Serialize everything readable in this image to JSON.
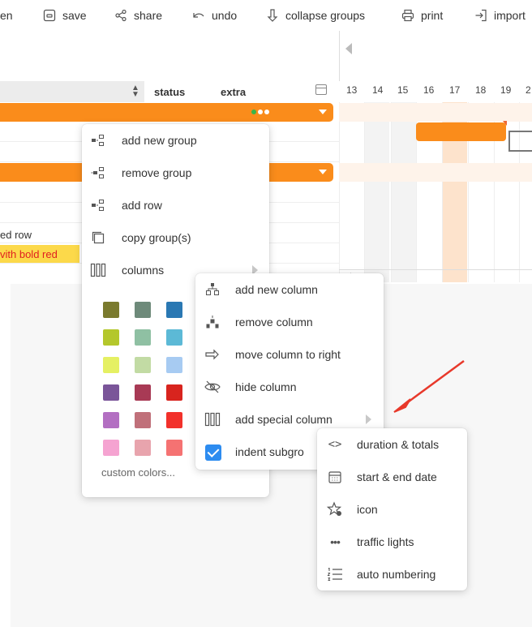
{
  "toolbar": {
    "items": [
      {
        "label": "en",
        "icon": "none"
      },
      {
        "label": "save",
        "icon": "save-icon"
      },
      {
        "label": "share",
        "icon": "share-icon"
      },
      {
        "label": "undo",
        "icon": "undo-icon"
      },
      {
        "label": "collapse groups",
        "icon": "collapse-icon"
      },
      {
        "label": "print",
        "icon": "print-icon"
      },
      {
        "label": "import",
        "icon": "import-icon"
      }
    ]
  },
  "grid": {
    "headers": {
      "status": "status",
      "extra": "extra"
    },
    "days": [
      "13",
      "14",
      "15",
      "16",
      "17",
      "18",
      "19",
      "2"
    ],
    "rows": {
      "red_row_text": "ed row",
      "bold_red_text": "vith bold red"
    },
    "colors": {
      "group": "#fa8c1b",
      "highlight_day": "#fde3cc",
      "yellow": "#fcd94a",
      "bold_red": "#e02020"
    }
  },
  "context_menu": {
    "items": [
      {
        "label": "add new group",
        "icon": "add-group-icon"
      },
      {
        "label": "remove group",
        "icon": "remove-group-icon"
      },
      {
        "label": "add row",
        "icon": "add-row-icon"
      },
      {
        "label": "copy group(s)",
        "icon": "copy-icon"
      },
      {
        "label": "columns",
        "icon": "columns-icon"
      }
    ],
    "swatches": [
      [
        "#7a7a2e",
        "#6e8a7a",
        "#2a78b3"
      ],
      [
        "#b4c72c",
        "#8fc0a3",
        "#5cb9d6"
      ],
      [
        "#e5f063",
        "#c2dba4",
        "#a7cbf2"
      ],
      [
        "#7a5599",
        "#a83a55",
        "#d8241e"
      ],
      [
        "#b36fc2",
        "#c0707a",
        "#f2312b"
      ],
      [
        "#f5a3d1",
        "#e8a4ad",
        "#f57272"
      ]
    ],
    "custom_colors": "custom colors..."
  },
  "columns_menu": {
    "items": [
      {
        "label": "add new column",
        "icon": "add-column-icon"
      },
      {
        "label": "remove column",
        "icon": "remove-column-icon"
      },
      {
        "label": "move column to right",
        "icon": "arrow-right-icon"
      },
      {
        "label": "hide column",
        "icon": "eye-off-icon"
      },
      {
        "label": "add special column",
        "icon": "columns-icon"
      },
      {
        "label": "indent subgro",
        "icon": "checkbox-icon"
      }
    ]
  },
  "special_menu": {
    "items": [
      {
        "label": "duration & totals",
        "icon": "code-icon"
      },
      {
        "label": "start & end date",
        "icon": "calendar-icon"
      },
      {
        "label": "icon",
        "icon": "star-icon"
      },
      {
        "label": "traffic lights",
        "icon": "dots-icon"
      },
      {
        "label": "auto numbering",
        "icon": "numbered-list-icon"
      }
    ]
  }
}
